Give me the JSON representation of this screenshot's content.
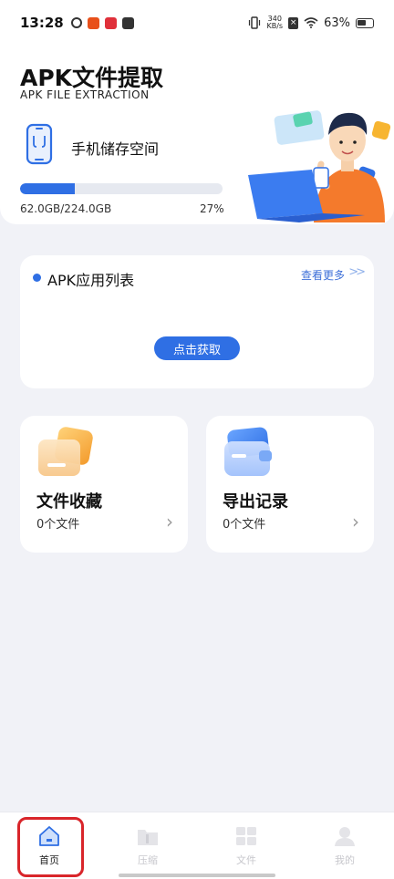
{
  "status_bar": {
    "time": "13:28",
    "net_speed_value": "340",
    "net_speed_unit": "KB/s",
    "battery": "63%",
    "battery_level": 0.63
  },
  "header": {
    "title": "APK文件提取",
    "subtitle": "APK FILE EXTRACTION",
    "storage_label": "手机储存空间",
    "storage_used": "62.0GB/224.0GB",
    "storage_percent": "27%",
    "storage_fraction": 0.27
  },
  "apk_card": {
    "title": "APK应用列表",
    "see_more": "查看更多",
    "get_button": "点击获取"
  },
  "cards": {
    "favorites": {
      "title": "文件收藏",
      "count": "0个文件"
    },
    "export": {
      "title": "导出记录",
      "count": "0个文件"
    }
  },
  "nav": {
    "home": "首页",
    "compress": "压缩",
    "files": "文件",
    "mine": "我的"
  },
  "colors": {
    "accent": "#2f6fe4",
    "highlight_box": "#d9252a"
  }
}
